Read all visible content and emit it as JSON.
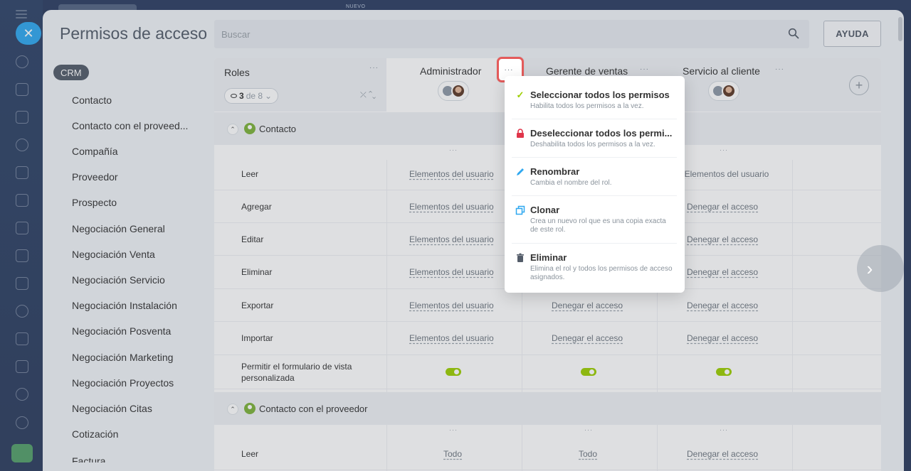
{
  "topbar": {
    "nuevo_label": "NUEVO"
  },
  "header": {
    "title": "Permisos de acceso",
    "search_placeholder": "Buscar",
    "help_label": "AYUDA"
  },
  "sidebar": {
    "section": "CRM",
    "items": [
      "Contacto",
      "Contacto con el proveed...",
      "Compañía",
      "Proveedor",
      "Prospecto",
      "Negociación General",
      "Negociación Venta",
      "Negociación Servicio",
      "Negociación Instalación",
      "Negociación Posventa",
      "Negociación Marketing",
      "Negociación Proyectos",
      "Negociación Citas",
      "Cotización",
      "Factura"
    ]
  },
  "roles": {
    "label": "Roles",
    "count_current": "3",
    "count_suffix": "de 8",
    "columns": [
      {
        "name": "Administrador"
      },
      {
        "name": "Gerente de ventas"
      },
      {
        "name": "Servicio al cliente"
      }
    ]
  },
  "sections": [
    {
      "title": "Contacto",
      "rows": [
        {
          "label": "Leer",
          "values": [
            "Elementos del usuario",
            "",
            "Elementos del usuario"
          ]
        },
        {
          "label": "Agregar",
          "values": [
            "Elementos del usuario",
            "",
            "Denegar el acceso"
          ]
        },
        {
          "label": "Editar",
          "values": [
            "Elementos del usuario",
            "",
            "Denegar el acceso"
          ]
        },
        {
          "label": "Eliminar",
          "values": [
            "Elementos del usuario",
            "",
            "Denegar el acceso"
          ]
        },
        {
          "label": "Exportar",
          "values": [
            "Elementos del usuario",
            "Denegar el acceso",
            "Denegar el acceso"
          ]
        },
        {
          "label": "Importar",
          "values": [
            "Elementos del usuario",
            "Denegar el acceso",
            "Denegar el acceso"
          ]
        },
        {
          "label": "Permitir el formulario de vista personalizada",
          "values": [
            "toggle-on",
            "toggle-on",
            "toggle-on"
          ]
        }
      ]
    },
    {
      "title": "Contacto con el proveedor",
      "rows": [
        {
          "label": "Leer",
          "values": [
            "Todo",
            "Todo",
            "Denegar el acceso"
          ]
        }
      ]
    }
  ],
  "popup_menu": {
    "items": [
      {
        "title": "Seleccionar todos los permisos",
        "desc": "Habilita todos los permisos a la vez.",
        "icon": "check-icon"
      },
      {
        "title": "Deseleccionar todos los permi...",
        "desc": "Deshabilita todos los permisos a la vez.",
        "icon": "lock-icon"
      },
      {
        "title": "Renombrar",
        "desc": "Cambia el nombre del rol.",
        "icon": "pencil-icon"
      },
      {
        "title": "Clonar",
        "desc": "Crea un nuevo rol que es una copia exacta de este rol.",
        "icon": "copy-icon"
      },
      {
        "title": "Eliminar",
        "desc": "Elimina el rol y todos los permisos de acceso asignados.",
        "icon": "trash-icon"
      }
    ]
  },
  "colors": {
    "accent_blue": "#2fa8f0",
    "toggle_green": "#9dcf00",
    "highlight_red": "#e45b5b",
    "check_green": "#9dcf00",
    "lock_red": "#e0354a"
  }
}
